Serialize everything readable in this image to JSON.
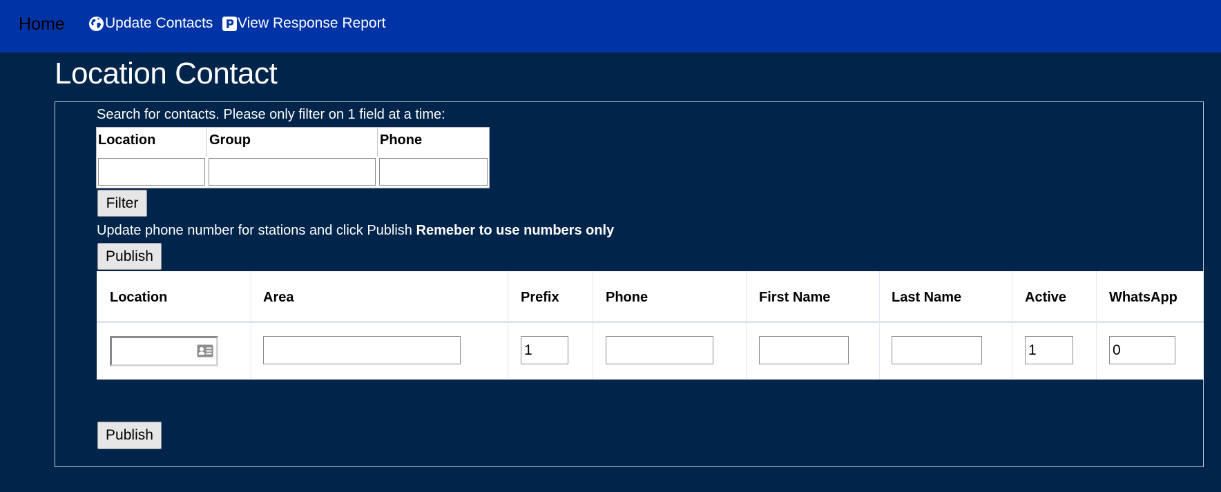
{
  "nav": {
    "home_label": "Home",
    "links": [
      {
        "label": "Update Contacts",
        "icon": "globe-icon"
      },
      {
        "label": "View Response Report",
        "icon": "parking-icon"
      }
    ]
  },
  "page": {
    "title": "Location Contact"
  },
  "filter": {
    "instruction": "Search for contacts. Please only filter on 1 field at a time:",
    "columns": [
      "Location",
      "Group",
      "Phone"
    ],
    "values": [
      "",
      "",
      ""
    ],
    "button_label": "Filter"
  },
  "update": {
    "instruction": "Update phone number for stations and click Publish ",
    "instruction_bold": "Remeber to use numbers only",
    "publish_label": "Publish"
  },
  "grid": {
    "columns": [
      "Location",
      "Area",
      "Prefix",
      "Phone",
      "First Name",
      "Last Name",
      "Active",
      "WhatsApp"
    ],
    "row": {
      "location": "",
      "area": "",
      "prefix": "1",
      "phone": "",
      "first_name": "",
      "last_name": "",
      "active": "1",
      "whatsapp": "0"
    }
  },
  "footer": {
    "publish_label": "Publish"
  },
  "colors": {
    "navbar": "#0033a6",
    "background": "#00244a"
  }
}
